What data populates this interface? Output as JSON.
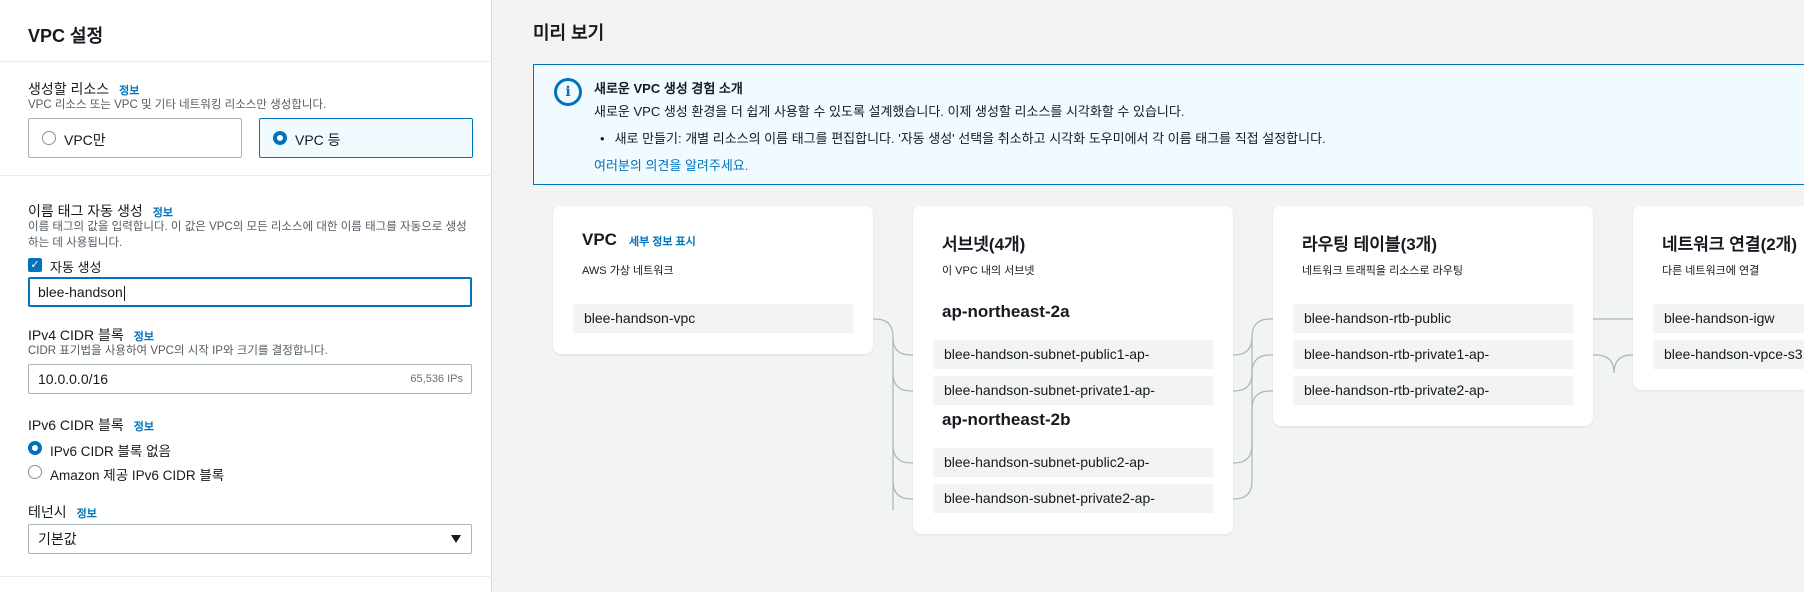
{
  "settings": {
    "title": "VPC 설정",
    "resources": {
      "label": "생성할 리소스",
      "info": "정보",
      "description": "VPC 리소스 또는 VPC 및 기타 네트워킹 리소스만 생성합니다.",
      "option_vpc_only": "VPC만",
      "option_vpc_more": "VPC 등",
      "selected": "VPC 등"
    },
    "name_tag": {
      "label": "이름 태그 자동 생성",
      "info": "정보",
      "description": "이름 태그의 값을 입력합니다. 이 값은 VPC의 모든 리소스에 대한 이름 태그를 자동으로 생성하는 데 사용됩니다.",
      "auto_generate_label": "자동 생성",
      "auto_generate_checked": true,
      "value": "blee-handson"
    },
    "ipv4": {
      "label": "IPv4 CIDR 블록",
      "info": "정보",
      "description": "CIDR 표기법을 사용하여 VPC의 시작 IP와 크기를 결정합니다.",
      "value": "10.0.0.0/16",
      "ip_count": "65,536 IPs"
    },
    "ipv6": {
      "label": "IPv6 CIDR 블록",
      "info": "정보",
      "option_none": "IPv6 CIDR 블록 없음",
      "option_amazon": "Amazon 제공 IPv6 CIDR 블록",
      "selected": "IPv6 CIDR 블록 없음"
    },
    "tenancy": {
      "label": "테넌시",
      "info": "정보",
      "value": "기본값"
    }
  },
  "preview": {
    "title": "미리 보기",
    "banner": {
      "icon": "info-icon",
      "title": "새로운 VPC 생성 경험 소개",
      "text": "새로운 VPC 생성 환경을 더 쉽게 사용할 수 있도록 설계했습니다. 이제 생성할 리소스를 시각화할 수 있습니다.",
      "bullet": "새로 만들기: 개별 리소스의 이름 태그를 편집합니다. '자동 생성' 선택을 취소하고 시각화 도우미에서 각 이름 태그를 직접 설정합니다.",
      "link": "여러분의 의견을 알려주세요."
    },
    "vpc_card": {
      "title": "VPC",
      "details_link": "세부 정보 표시",
      "subtitle": "AWS 가상 네트워크",
      "vpc_name": "blee-handson-vpc"
    },
    "subnet_card": {
      "title": "서브넷(4개)",
      "subtitle": "이 VPC 내의 서브넷",
      "az1": "ap-northeast-2a",
      "az1_subnets": [
        "blee-handson-subnet-public1-ap-",
        "blee-handson-subnet-private1-ap-"
      ],
      "az2": "ap-northeast-2b",
      "az2_subnets": [
        "blee-handson-subnet-public2-ap-",
        "blee-handson-subnet-private2-ap-"
      ]
    },
    "route_card": {
      "title": "라우팅 테이블(3개)",
      "subtitle": "네트워크 트래픽을 리소스로 라우팅",
      "tables": [
        "blee-handson-rtb-public",
        "blee-handson-rtb-private1-ap-",
        "blee-handson-rtb-private2-ap-"
      ]
    },
    "network_card": {
      "title": "네트워크 연결(2개)",
      "subtitle": "다른 네트워크에 연결",
      "connections": [
        "blee-handson-igw",
        "blee-handson-vpce-s3"
      ]
    },
    "colors": {
      "accent": "#0073bb",
      "connector": "#aab7b8",
      "node_bg": "#f2f3f3"
    }
  }
}
